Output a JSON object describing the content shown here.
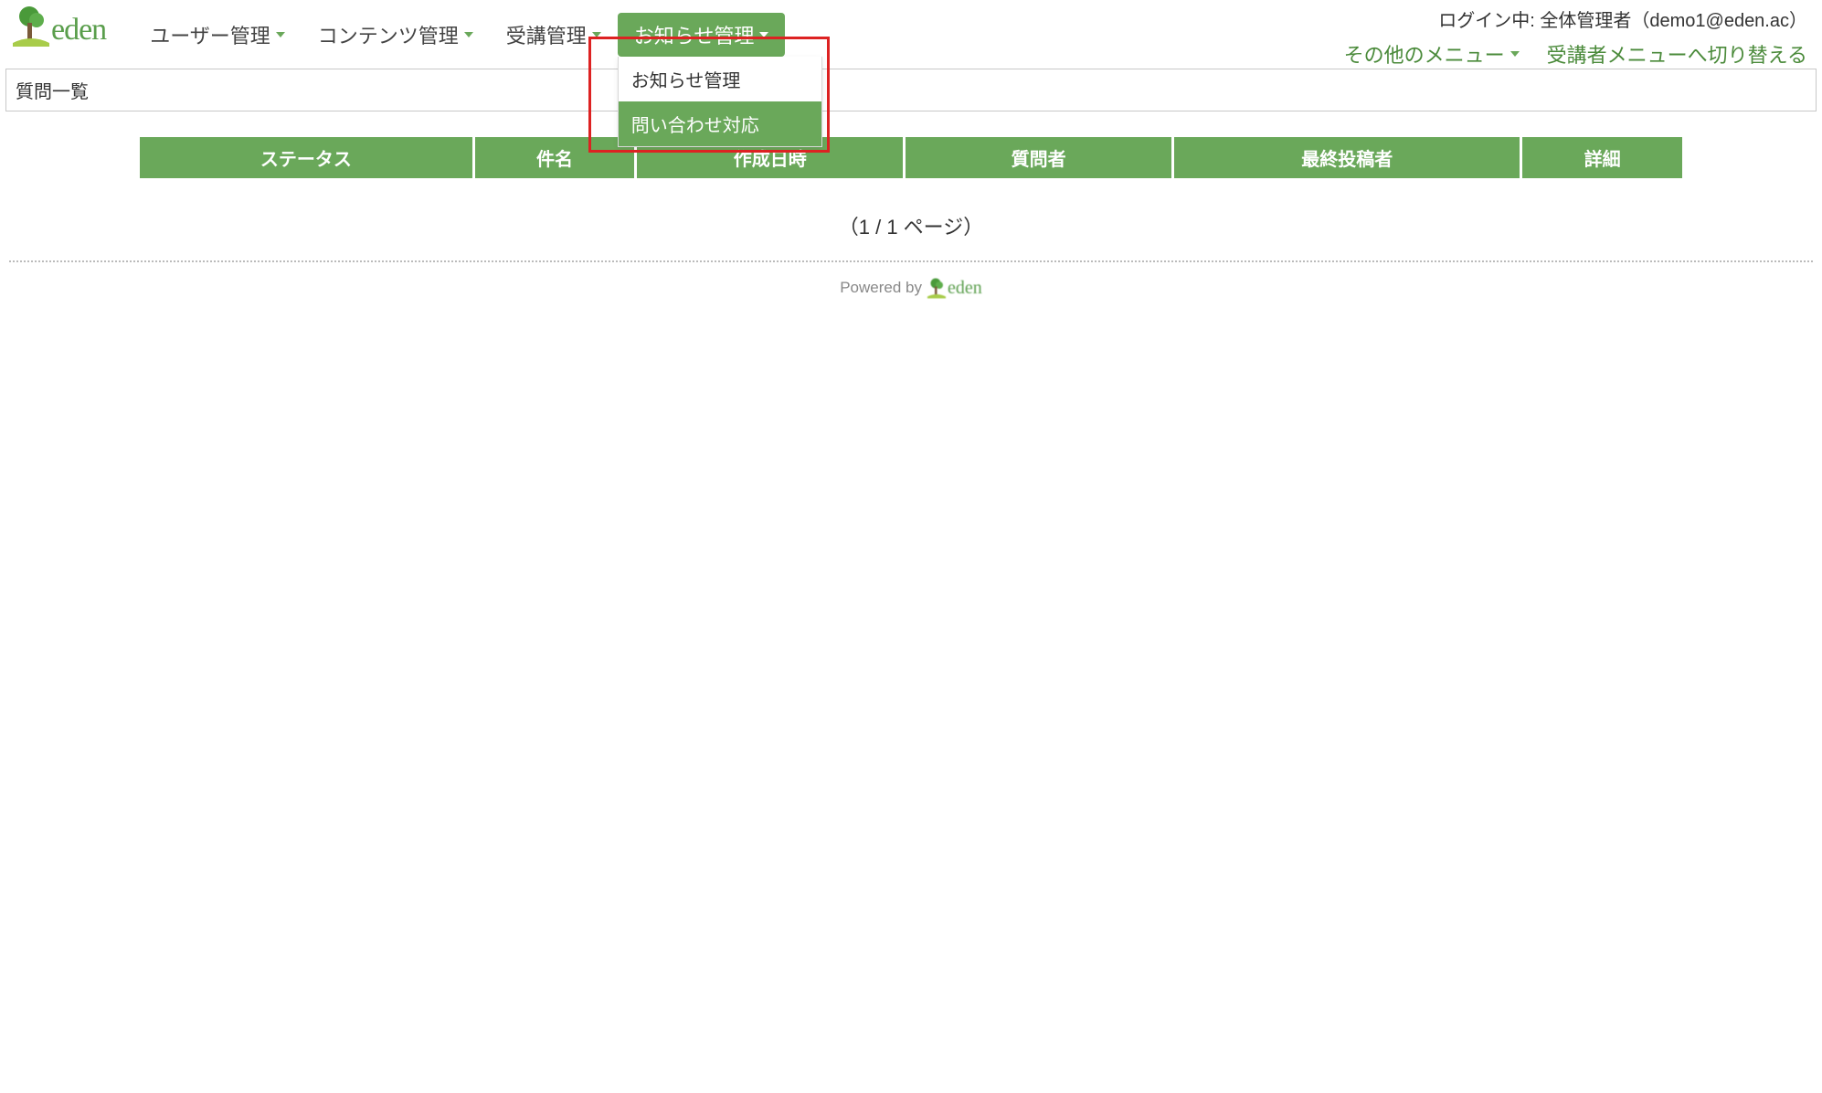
{
  "brand": {
    "name": "eden"
  },
  "nav": {
    "items": [
      {
        "label": "ユーザー管理"
      },
      {
        "label": "コンテンツ管理"
      },
      {
        "label": "受講管理"
      },
      {
        "label": "お知らせ管理",
        "active": true,
        "dropdown": [
          {
            "label": "お知らせ管理",
            "highlighted": false
          },
          {
            "label": "問い合わせ対応",
            "highlighted": true
          }
        ]
      }
    ]
  },
  "header_right": {
    "login_label": "ログイン中: 全体管理者（demo1@eden.ac）",
    "other_menu": "その他のメニュー",
    "switch_link": "受講者メニューへ切り替える"
  },
  "page_title": "質問一覧",
  "table": {
    "headers": {
      "status": "ステータス",
      "subject": "件名",
      "created": "作成日時",
      "asker": "質問者",
      "last_poster": "最終投稿者",
      "detail": "詳細"
    }
  },
  "pagination": "（1 / 1 ページ）",
  "footer": {
    "powered_by": "Powered by",
    "brand": "eden"
  }
}
